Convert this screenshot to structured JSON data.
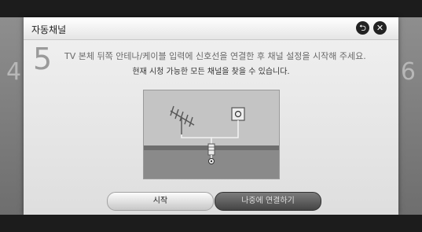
{
  "dialog": {
    "title": "자동채널",
    "back_icon": "back-arrow-icon",
    "close_icon": "close-icon"
  },
  "step": {
    "previous": "4",
    "current": "5",
    "next": "6"
  },
  "instructions": {
    "line1": "TV 본체 뒤쪽 안테나/케이블 입력에 신호선을 연결한 후 채널 설정을 시작해 주세요.",
    "line2": "현재 시청 가능한 모든 채널을 찾을 수 있습니다."
  },
  "buttons": {
    "start": "시작",
    "later": "나중에 연결하기"
  },
  "colors": {
    "dialog_bg": "#e8e8e8",
    "illustration_bg": "#bdbdbd",
    "secondary_button": "#5a5a5a"
  }
}
